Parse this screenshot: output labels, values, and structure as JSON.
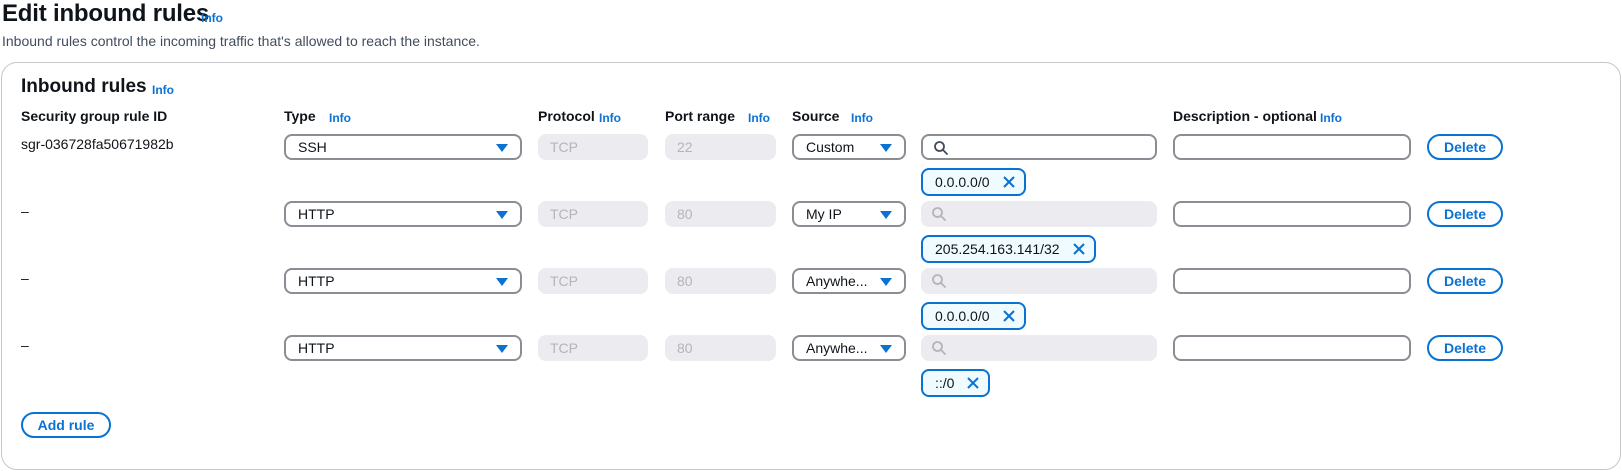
{
  "header": {
    "title": "Edit inbound rules",
    "info": "Info",
    "subtitle": "Inbound rules control the incoming traffic that's allowed to reach the instance."
  },
  "card": {
    "title": "Inbound rules",
    "info": "Info",
    "columns": {
      "rule_id": "Security group rule ID",
      "type": "Type",
      "protocol": "Protocol",
      "port_range": "Port range",
      "source": "Source",
      "description": "Description - optional",
      "info": "Info"
    },
    "rules": [
      {
        "id": "sgr-036728fa50671982b",
        "type": "SSH",
        "protocol": "TCP",
        "port": "22",
        "source": "Custom",
        "search_enabled": true,
        "token": "0.0.0.0/0",
        "description": "",
        "delete_label": "Delete"
      },
      {
        "id": "–",
        "type": "HTTP",
        "protocol": "TCP",
        "port": "80",
        "source": "My IP",
        "search_enabled": false,
        "token": "205.254.163.141/32",
        "description": "",
        "delete_label": "Delete"
      },
      {
        "id": "–",
        "type": "HTTP",
        "protocol": "TCP",
        "port": "80",
        "source": "Anywhe...",
        "search_enabled": false,
        "token": "0.0.0.0/0",
        "description": "",
        "delete_label": "Delete"
      },
      {
        "id": "–",
        "type": "HTTP",
        "protocol": "TCP",
        "port": "80",
        "source": "Anywhe...",
        "search_enabled": false,
        "token": "::/0",
        "description": "",
        "delete_label": "Delete"
      }
    ],
    "add_rule_label": "Add rule"
  },
  "colors": {
    "accent": "#0972d3",
    "border": "#8c8c94",
    "disabled_bg": "#ebebf0",
    "token_bg": "#f0fbff"
  },
  "icons": {
    "search": "search-icon",
    "caret": "caret-down-icon",
    "dismiss": "close-icon"
  }
}
